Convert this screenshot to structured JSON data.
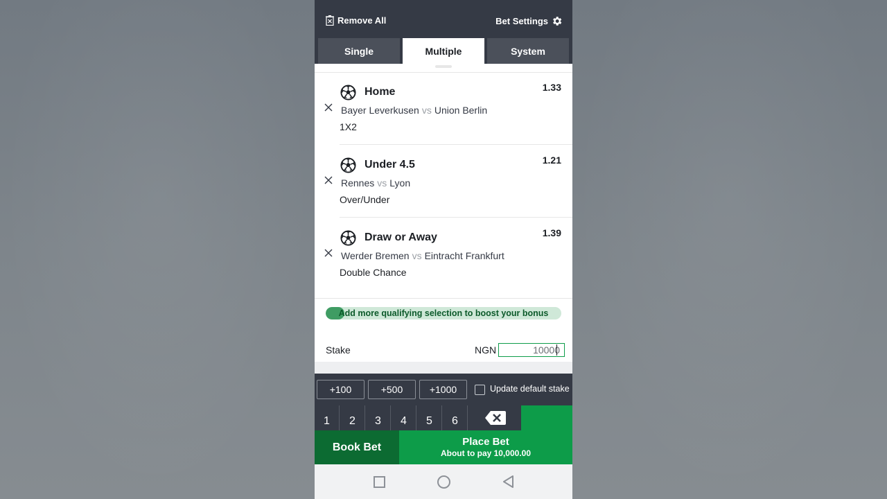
{
  "header": {
    "remove_all": "Remove All",
    "bet_settings": "Bet Settings"
  },
  "tabs": [
    {
      "label": "Single",
      "active": false
    },
    {
      "label": "Multiple",
      "active": true
    },
    {
      "label": "System",
      "active": false
    }
  ],
  "selections": [
    {
      "pick": "Home",
      "odds": "1.33",
      "home": "Bayer Leverkusen",
      "vs": "vs",
      "away": "Union Berlin",
      "market": "1X2",
      "icon": "soccer-ball-icon"
    },
    {
      "pick": "Under 4.5",
      "odds": "1.21",
      "home": "Rennes",
      "vs": "vs",
      "away": "Lyon",
      "market": "Over/Under",
      "icon": "soccer-ball-icon"
    },
    {
      "pick": "Draw or Away",
      "odds": "1.39",
      "home": "Werder Bremen",
      "vs": "vs",
      "away": "Eintracht Frankfurt",
      "market": "Double Chance",
      "icon": "soccer-ball-icon"
    }
  ],
  "bonus": {
    "text": "Add more qualifying selection to boost your bonus",
    "progress": 0.08
  },
  "stake": {
    "label": "Stake",
    "currency": "NGN",
    "value": "10000"
  },
  "quick_stake": {
    "buttons": [
      "+100",
      "+500",
      "+1000"
    ],
    "update_default_label": "Update default stake",
    "update_default_checked": false
  },
  "keypad": {
    "keys": [
      "1",
      "2",
      "3",
      "4",
      "5",
      "6"
    ],
    "delete_icon": "backspace-icon"
  },
  "actions": {
    "book_bet": "Book Bet",
    "place_bet": "Place Bet",
    "pay_text": "About to pay 10,000.00"
  },
  "colors": {
    "header": "#353a45",
    "accent_green": "#0d9c49",
    "dark_green": "#0c6b32"
  }
}
